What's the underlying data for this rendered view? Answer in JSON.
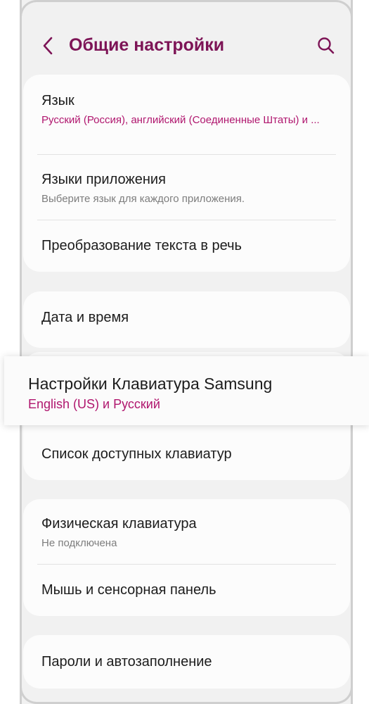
{
  "header": {
    "title": "Общие настройки",
    "back_icon": "chevron-left-icon",
    "search_icon": "search-icon"
  },
  "colors": {
    "accent": "#7d1456",
    "subtitle_accent": "#b0166e",
    "background": "#f1f1f1",
    "card": "#fcfcfc"
  },
  "groups": [
    {
      "items": [
        {
          "title": "Язык",
          "subtitle": "Русский (Россия), английский (Соединенные Штаты) и ..."
        },
        {
          "title": "Языки приложения",
          "subtitle": "Выберите язык для каждого приложения."
        },
        {
          "title": "Преобразование текста в речь"
        }
      ]
    },
    {
      "items": [
        {
          "title": "Дата и время"
        }
      ]
    },
    {
      "items": [
        {
          "title": "Настройки Клавиатура Samsung",
          "subtitle": "English (US) и Русский"
        },
        {
          "title": "Список доступных клавиатур"
        }
      ]
    },
    {
      "items": [
        {
          "title": "Физическая клавиатура",
          "subtitle": "Не подключена"
        },
        {
          "title": "Мышь и сенсорная панель"
        }
      ]
    },
    {
      "items": [
        {
          "title": "Пароли и автозаполнение"
        }
      ]
    }
  ]
}
